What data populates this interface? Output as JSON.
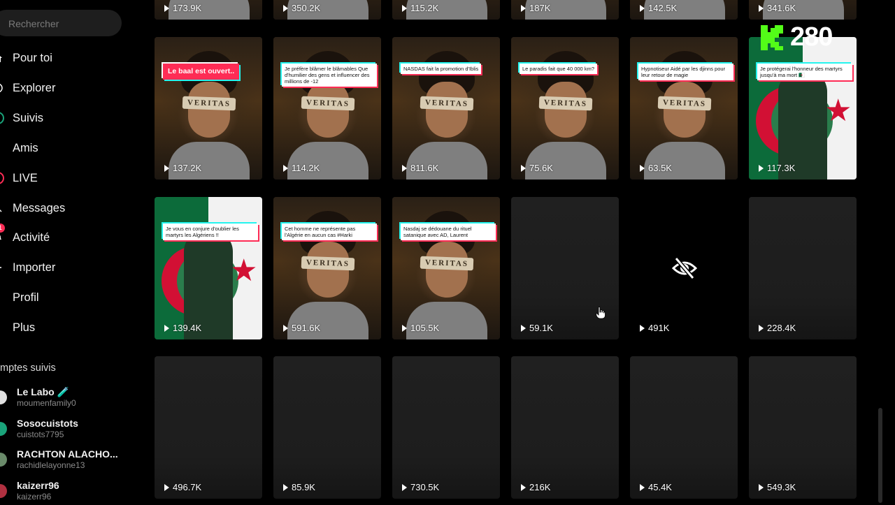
{
  "search": {
    "placeholder": "Rechercher"
  },
  "sidebar": {
    "items": [
      {
        "label": "Pour toi",
        "icon": "home-icon"
      },
      {
        "label": "Explorer",
        "icon": "compass-icon"
      },
      {
        "label": "Suivis",
        "icon": "following-icon"
      },
      {
        "label": "Amis",
        "icon": "friends-icon"
      },
      {
        "label": "LIVE",
        "icon": "live-icon"
      },
      {
        "label": "Messages",
        "icon": "message-icon"
      },
      {
        "label": "Activité",
        "icon": "bell-icon",
        "badge": "1"
      },
      {
        "label": "Importer",
        "icon": "upload-icon"
      },
      {
        "label": "Profil",
        "icon": "profile-icon"
      },
      {
        "label": "Plus",
        "icon": "more-icon"
      }
    ],
    "followed_title": "mptes suivis",
    "followed": [
      {
        "name": "Le Labo 🧪",
        "handle": "moumenfamily0",
        "color": "#e0e0e0"
      },
      {
        "name": "Sosocuistots",
        "handle": "cuistots7795",
        "color": "#1aa37a"
      },
      {
        "name": "RACHTON ALACHO...",
        "handle": "rachidlelayonne13",
        "color": "#6a8a6a"
      },
      {
        "name": "kaizerr96",
        "handle": "kaizerr96",
        "color": "#b03040"
      }
    ]
  },
  "grid": {
    "top_row": [
      "173.9K",
      "350.2K",
      "115.2K",
      "187K",
      "142.5K",
      "341.6K"
    ],
    "row1": [
      {
        "views": "137.2K",
        "thumb": "veritas",
        "caption": "Le baal est ouvert..",
        "caption_style": "pink"
      },
      {
        "views": "114.2K",
        "thumb": "veritas",
        "caption": "Je préfère blâmer le blâmables Que d'humilier des gens et influencer des millions de -12"
      },
      {
        "views": "811.6K",
        "thumb": "veritas",
        "caption": "NASDAS fait la promotion d'Iblis"
      },
      {
        "views": "75.6K",
        "thumb": "veritas",
        "caption": "Le paradis fait que 40 000 km?"
      },
      {
        "views": "63.5K",
        "thumb": "veritas",
        "caption": "Hypnotiseur Aidé par les djinns pour leur retour de magie"
      },
      {
        "views": "117.3K",
        "thumb": "flag",
        "caption": "Je protégerai l'honneur des martyrs jusqu'à ma mort 🇩🇿"
      }
    ],
    "row2": [
      {
        "views": "139.4K",
        "thumb": "flag",
        "caption": "Je vous en conjure d'oublier les martyrs les Algériens !!"
      },
      {
        "views": "591.6K",
        "thumb": "veritas",
        "caption": "Cet homme ne représente pas l'Algérie en aucun cas #Harki"
      },
      {
        "views": "105.5K",
        "thumb": "veritas",
        "caption": "Nasdaj se dédouane du rituel satanique avec AD, Laurent"
      },
      {
        "views": "59.1K",
        "thumb": "empty"
      },
      {
        "views": "491K",
        "thumb": "hidden"
      },
      {
        "views": "228.4K",
        "thumb": "empty"
      }
    ],
    "row3": [
      "496.7K",
      "85.9K",
      "730.5K",
      "216K",
      "45.4K",
      "549.3K"
    ],
    "thumb_text": "VERITAS"
  },
  "overlay": {
    "kick_count": "280",
    "kick_color": "#53fc18"
  },
  "colors": {
    "accent_pink": "#fe2c55",
    "accent_cyan": "#25f4ee",
    "tile_bg": "#1f1f1f"
  }
}
